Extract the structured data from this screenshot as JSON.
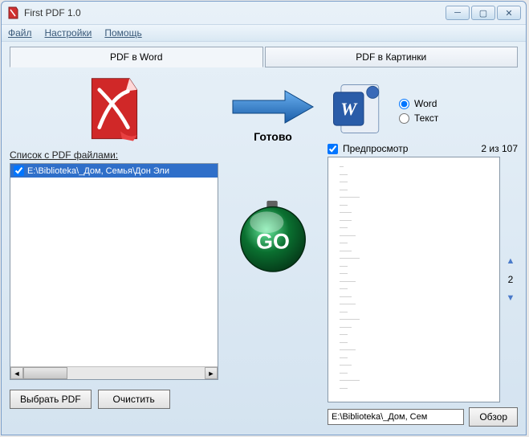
{
  "window": {
    "title": "First PDF 1.0"
  },
  "menu": {
    "file": "Файл",
    "settings": "Настройки",
    "help": "Помощь"
  },
  "tabs": {
    "word": "PDF в Word",
    "images": "PDF в Картинки"
  },
  "format": {
    "word": "Word",
    "text": "Текст"
  },
  "left": {
    "label": "Список с PDF файлами:",
    "item": "E:\\Biblioteka\\_Дом, Семья\\Дон Эли",
    "choose": "Выбрать PDF",
    "clear": "Очистить"
  },
  "status": "Готово",
  "go": "GO",
  "preview": {
    "label": "Предпросмотр",
    "counter": "2 из 107",
    "page_num": "2",
    "path": "E:\\Biblioteka\\_Дом, Сем",
    "browse": "Обзор"
  }
}
